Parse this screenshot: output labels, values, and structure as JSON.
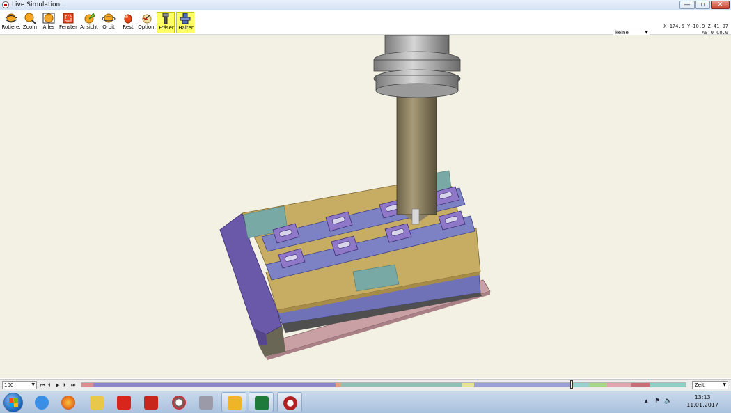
{
  "window": {
    "title": "Live Simulation...",
    "buttons": {
      "minimize": "—",
      "restore": "▫",
      "close": "✕"
    }
  },
  "toolbar": {
    "tools": [
      {
        "label": "Rotiere.",
        "icon": "rotate-icon",
        "color": "#f5a623"
      },
      {
        "label": "Zoom",
        "icon": "zoom-icon",
        "color": "#f5a623"
      },
      {
        "label": "Alles",
        "icon": "zoom-all-icon",
        "color": "#f5a623"
      },
      {
        "label": "Fenster",
        "icon": "zoom-window-icon",
        "color": "#e84a1c"
      },
      {
        "label": "Ansicht",
        "icon": "view-icon",
        "color": "#7cbf3a"
      },
      {
        "label": "Orbit",
        "icon": "orbit-icon",
        "color": "#f5a623"
      },
      {
        "label": "Rest",
        "icon": "rest-material-icon",
        "color": "#e84a1c"
      },
      {
        "label": "Option.",
        "icon": "options-icon",
        "color": "#f5a623"
      },
      {
        "label": "Fräser",
        "icon": "cutter-icon",
        "color": "#ffff66"
      },
      {
        "label": "Halter",
        "icon": "holder-icon",
        "color": "#ffff66"
      }
    ],
    "mode_select": "keine",
    "coordinates": [
      "X-174.5 Y-10.9 Z-41.97",
      "A0.0 C0.0"
    ]
  },
  "viewport": {
    "background": "#f2f1e4"
  },
  "playback": {
    "speed": "100",
    "buttons": [
      "⏮",
      "⏴",
      "▶",
      "⏵",
      "⏭"
    ],
    "time_select": "Zeit",
    "progress": 0.81
  },
  "taskbar": {
    "apps": [
      {
        "name": "ie-icon",
        "color": "#3a8ee6",
        "open": false
      },
      {
        "name": "firefox-icon",
        "color": "#e8701c",
        "open": false
      },
      {
        "name": "explorer-icon",
        "color": "#e8c84a",
        "open": false
      },
      {
        "name": "solidworks-icon",
        "color": "#d8261c",
        "open": false
      },
      {
        "name": "solidworks-cam-icon",
        "color": "#c8261c",
        "open": false
      },
      {
        "name": "cam-app-icon",
        "color": "#6a6a6a",
        "open": false
      },
      {
        "name": "tools-icon",
        "color": "#9a9aa8",
        "open": false
      },
      {
        "name": "outlook-icon",
        "color": "#f0b429",
        "open": true
      },
      {
        "name": "excel-icon",
        "color": "#1e7a3a",
        "open": true
      },
      {
        "name": "simulation-app-icon",
        "color": "#b02020",
        "open": true
      }
    ],
    "clock": {
      "time": "13:13",
      "date": "11.01.2017"
    }
  }
}
